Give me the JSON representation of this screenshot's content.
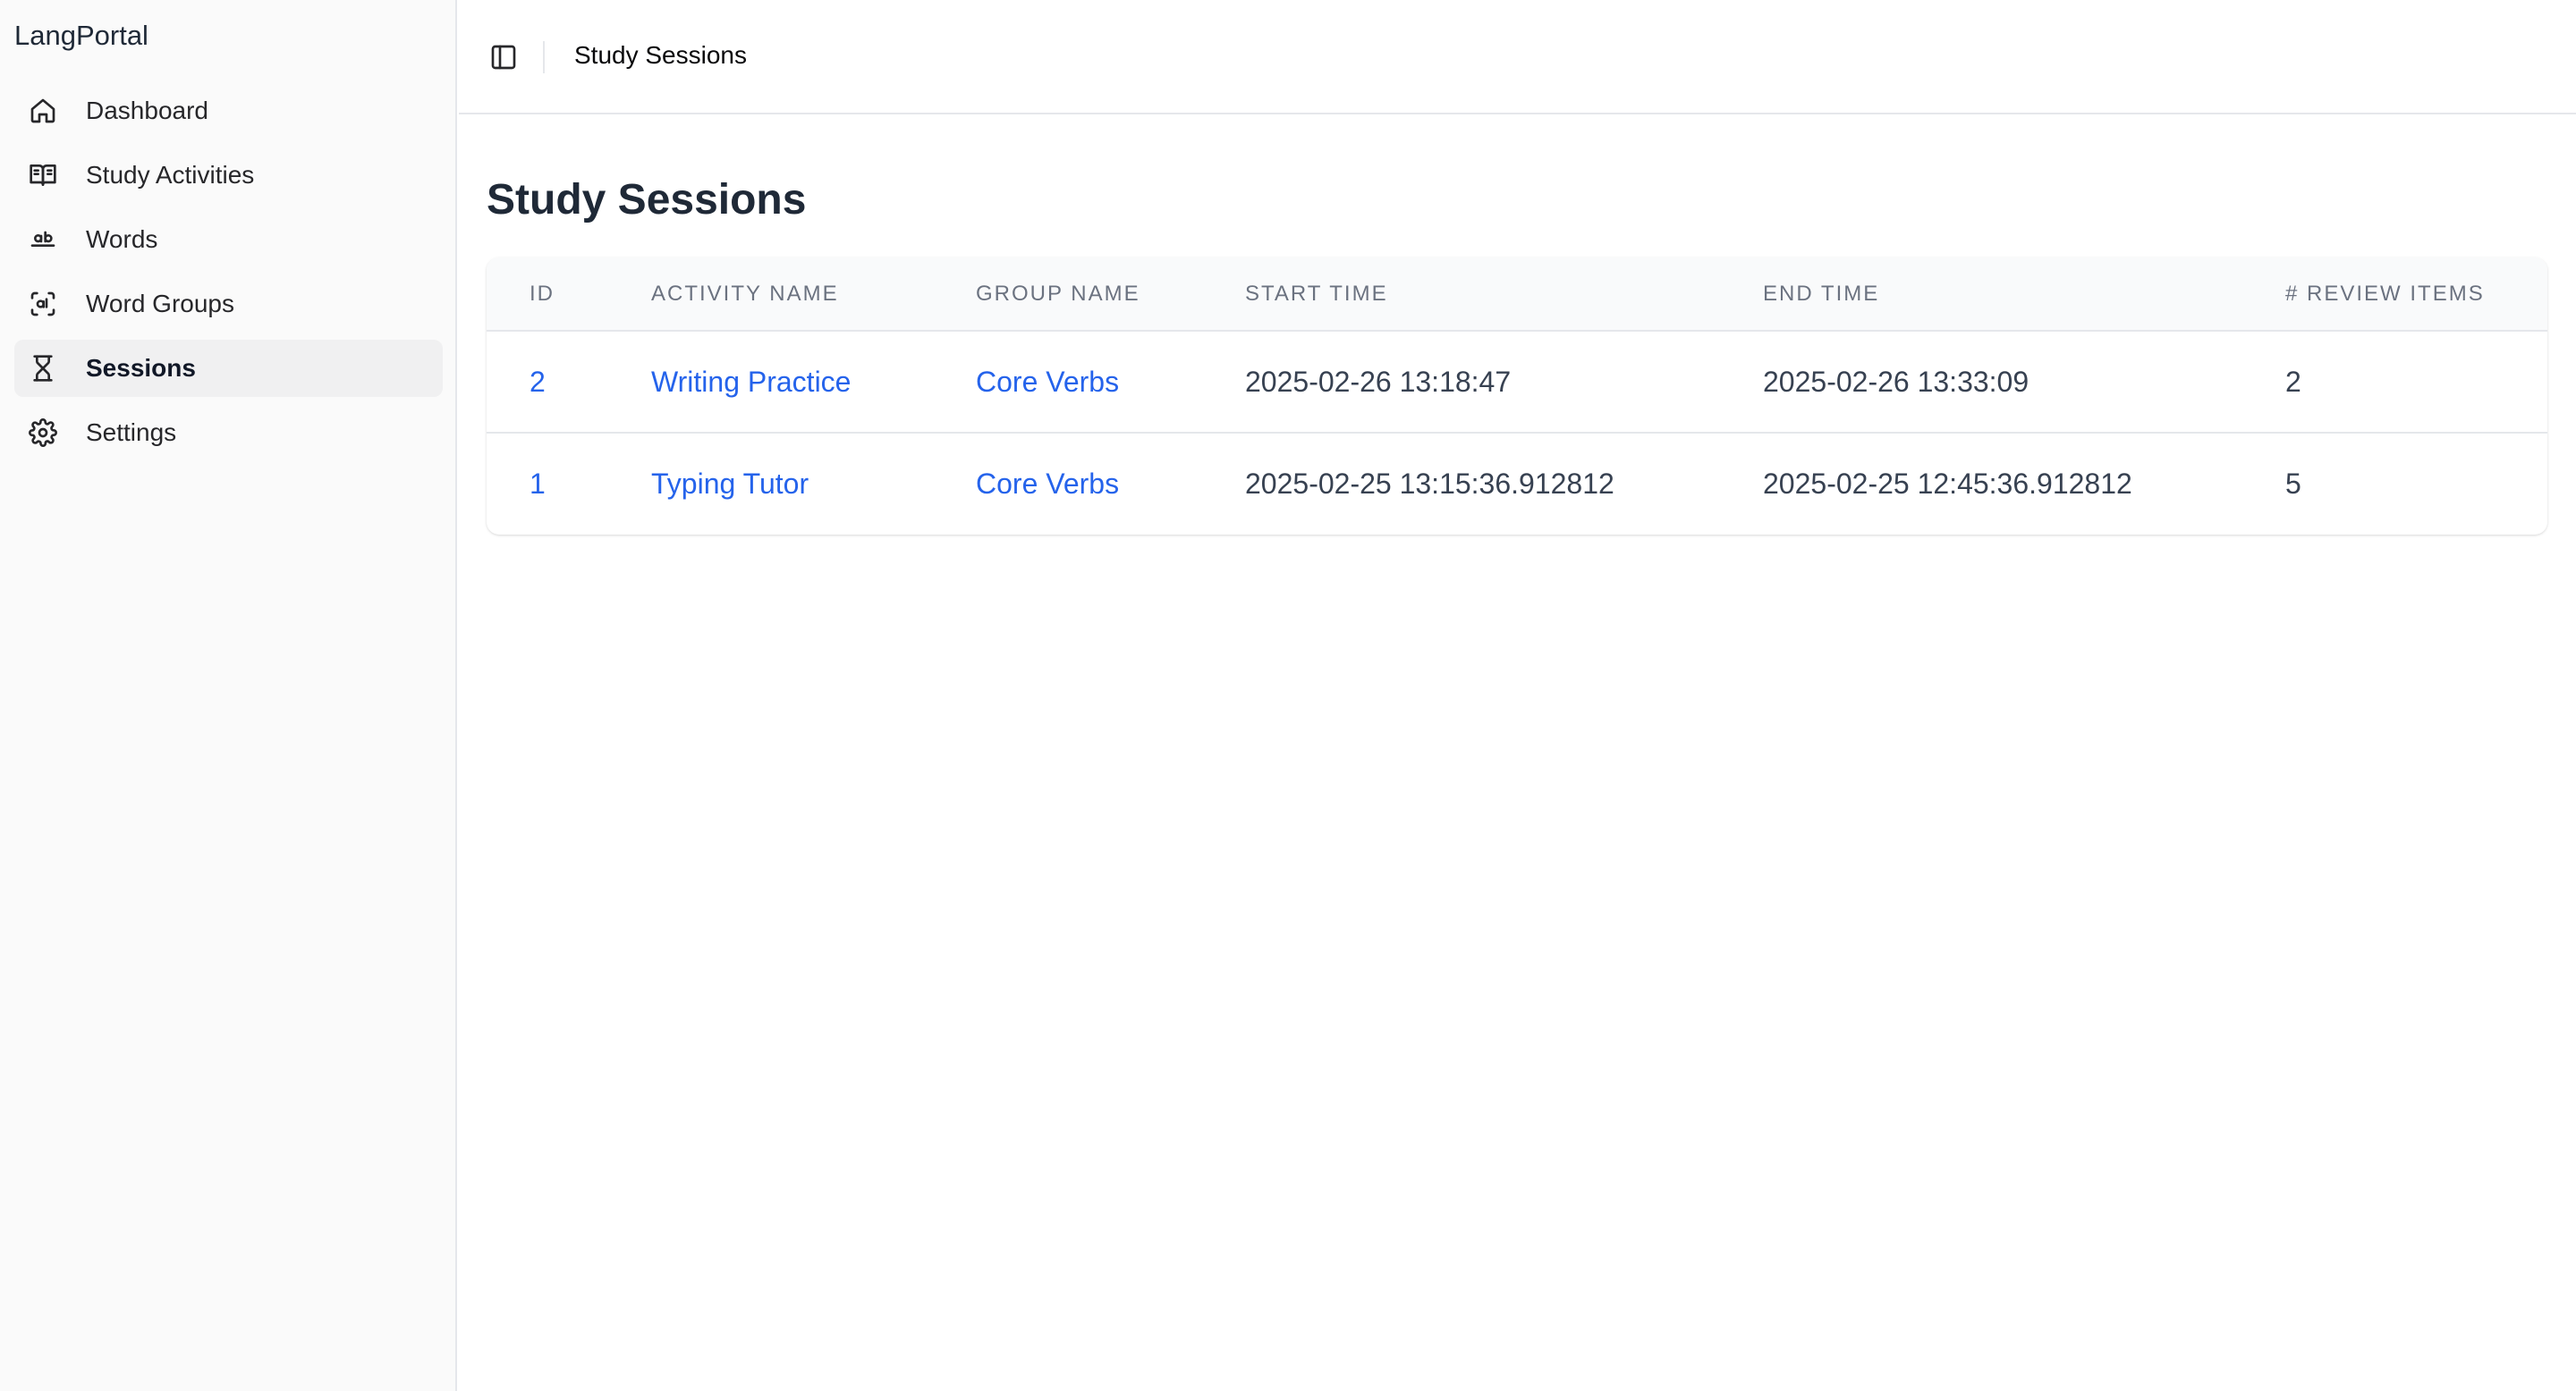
{
  "app": {
    "brand": "LangPortal"
  },
  "sidebar": {
    "items": [
      {
        "label": "Dashboard",
        "icon": "home-icon",
        "active": false
      },
      {
        "label": "Study Activities",
        "icon": "book-open-icon",
        "active": false
      },
      {
        "label": "Words",
        "icon": "alphabet-icon",
        "active": false
      },
      {
        "label": "Word Groups",
        "icon": "scan-text-icon",
        "active": false
      },
      {
        "label": "Sessions",
        "icon": "hourglass-icon",
        "active": true
      },
      {
        "label": "Settings",
        "icon": "gear-icon",
        "active": false
      }
    ]
  },
  "header": {
    "breadcrumb": "Study Sessions",
    "toggle_icon": "sidebar-toggle-icon"
  },
  "main": {
    "title": "Study Sessions",
    "table": {
      "columns": [
        "ID",
        "Activity Name",
        "Group Name",
        "Start Time",
        "End Time",
        "# Review Items"
      ],
      "rows": [
        {
          "id": "2",
          "activity": "Writing Practice",
          "group": "Core Verbs",
          "start": "2025-02-26 13:18:47",
          "end": "2025-02-26 13:33:09",
          "review_items": "2"
        },
        {
          "id": "1",
          "activity": "Typing Tutor",
          "group": "Core Verbs",
          "start": "2025-02-25 13:15:36.912812",
          "end": "2025-02-25 12:45:36.912812",
          "review_items": "5"
        }
      ]
    }
  },
  "colors": {
    "link": "#2563eb",
    "heading": "#1f2937",
    "sidebar_bg": "#fafafa",
    "active_bg": "#f0f0f1"
  }
}
